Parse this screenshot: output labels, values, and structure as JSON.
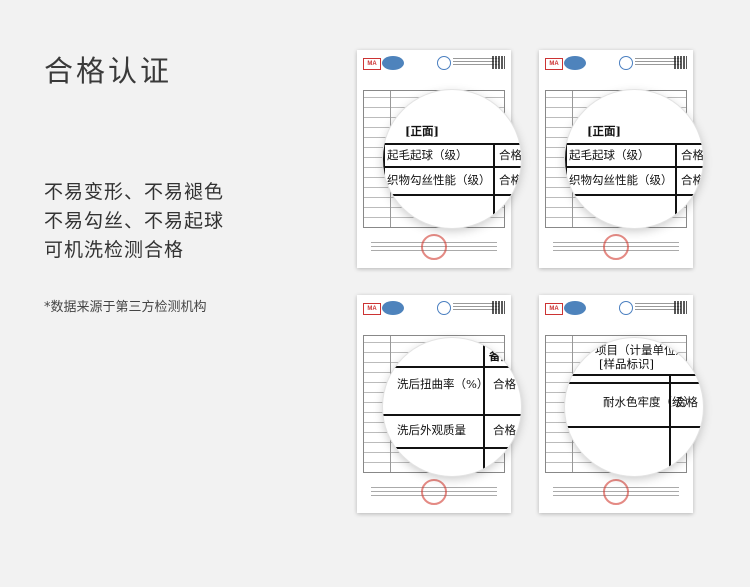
{
  "page": {
    "title": "合格认证",
    "features": [
      "不易变形、不易褪色",
      "不易勾丝、不易起球",
      "可机洗检测合格"
    ],
    "footnote": "*数据来源于第三方检测机构"
  },
  "reports": [
    {
      "heading": "[正面]",
      "rows": [
        {
          "label": "起毛起球（级）",
          "result": "合格"
        },
        {
          "label": "织物勾丝性能（级）",
          "result": "合格"
        }
      ]
    },
    {
      "heading": "[正面]",
      "rows": [
        {
          "label": "起毛起球（级）",
          "result": "合格"
        },
        {
          "label": "织物勾丝性能（级）",
          "result": "合格"
        }
      ]
    },
    {
      "heading": "备注",
      "rows": [
        {
          "label": "洗后扭曲率（%）",
          "result": "合格"
        },
        {
          "label": "洗后外观质量",
          "result": "合格"
        }
      ]
    },
    {
      "heading": "项目（计量单位）",
      "subheading": "[样品标识]",
      "rows": [
        {
          "label": "耐水色牢度（级）",
          "result": "合格"
        }
      ]
    }
  ],
  "colors": {
    "background": "#f2f2f2",
    "stamp": "#d23c32",
    "logo_blue": "#2f6db0"
  }
}
